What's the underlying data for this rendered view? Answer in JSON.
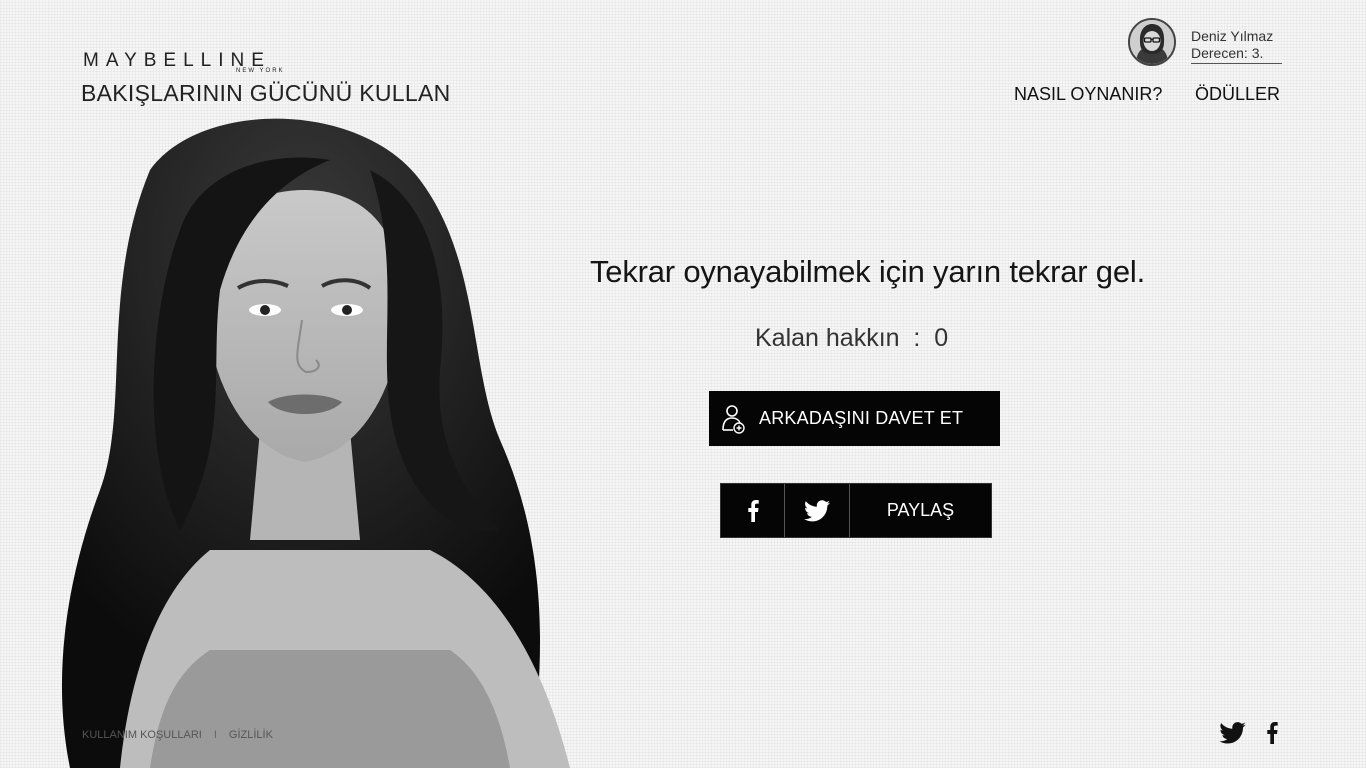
{
  "brand": {
    "logo_text": "MAYBELLINE",
    "logo_subtext": "NEW YORK",
    "tagline": "BAKIŞLARININ GÜCÜNÜ KULLAN"
  },
  "user": {
    "name": "Deniz Yılmaz",
    "level": "Derecen: 3."
  },
  "nav": {
    "how_to_play": "NASIL OYNANIR?",
    "prizes": "ÖDÜLLER"
  },
  "main": {
    "headline": "Tekrar oynayabilmek için yarın tekrar gel.",
    "remaining_label": "Kalan hakkın  :  0",
    "invite_button": "ARKADAŞINI DAVET ET",
    "share_button": "PAYLAŞ"
  },
  "footer": {
    "terms": "KULLANIM KOŞULLARI",
    "separator": "I",
    "privacy": "GİZLİLİK"
  },
  "icons": {
    "invite": "add-friend-icon",
    "facebook": "facebook-icon",
    "twitter": "twitter-icon"
  },
  "colors": {
    "button_bg": "#050505",
    "button_text": "#ffffff",
    "page_bg": "#f6f6f6"
  }
}
